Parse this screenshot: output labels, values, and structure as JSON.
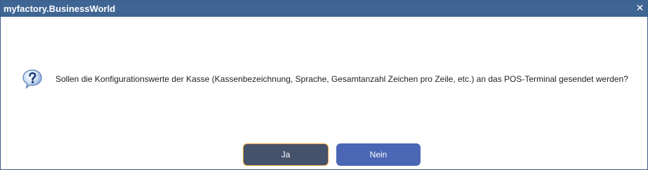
{
  "window": {
    "title": "myfactory.BusinessWorld",
    "close_glyph": "✕",
    "close_icon": "close-icon"
  },
  "dialog": {
    "icon": "question-icon",
    "message": "Sollen die Konfigurationswerte der Kasse (Kassenbezeichnung, Sprache, Gesamtanzahl Zeichen pro Zeile, etc.) an das POS-Terminal gesendet werden?"
  },
  "buttons": {
    "yes_label": "Ja",
    "no_label": "Nein"
  },
  "colors": {
    "titlebar": "#3e6593",
    "yes_button": "#45526b",
    "yes_focus_border": "#e8a23a",
    "no_button": "#4a66b5"
  }
}
